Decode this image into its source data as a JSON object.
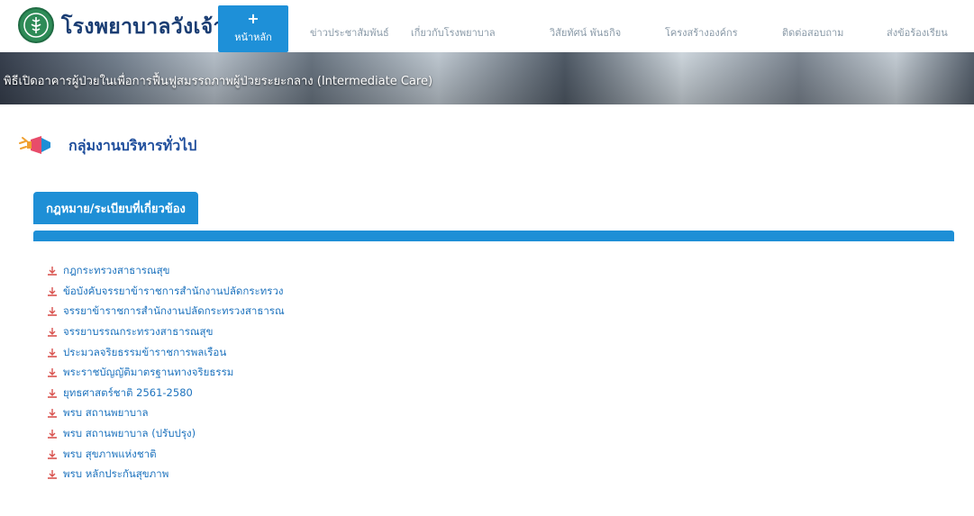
{
  "header": {
    "site_title": "โรงพยาบาลวังเจ้า",
    "logo_icon": "hospital-emblem-icon"
  },
  "nav": {
    "home": {
      "icon": "plus-icon",
      "label": "หน้าหลัก"
    },
    "items": [
      {
        "label": "ข่าวประชาสัมพันธ์"
      },
      {
        "label": "เกี่ยวกับโรงพยาบาล"
      },
      {
        "label": "วิสัยทัศน์ พันธกิจ"
      },
      {
        "label": "โครงสร้างองค์กร"
      },
      {
        "label": "ติดต่อสอบถาม"
      },
      {
        "label": "ส่งข้อร้องเรียน"
      }
    ]
  },
  "banner": {
    "caption": "พิธีเปิดอาคารผู้ป่วยในเพื่อการฟื้นฟูสมรรถภาพผู้ป่วยระยะกลาง (Intermediate Care)"
  },
  "section": {
    "icon": "megaphone-icon",
    "title": "กลุ่มงานบริหารทั่วไป"
  },
  "tab": {
    "label": "กฎหมาย/ระเบียบที่เกี่ยวข้อง"
  },
  "documents": [
    {
      "label": "กฎกระทรวงสาธารณสุข"
    },
    {
      "label": "ข้อบังคับจรรยาข้าราชการสำนักงานปลัดกระทรวง"
    },
    {
      "label": "จรรยาข้าราชการสำนักงานปลัดกระทรวงสาธารณ"
    },
    {
      "label": "จรรยาบรรณกระทรวงสาธารณสุข"
    },
    {
      "label": "ประมวลจริยธรรมข้าราชการพลเรือน"
    },
    {
      "label": "พระราชบัญญัติมาตรฐานทางจริยธรรม"
    },
    {
      "label": "ยุทธศาสตร์ชาติ 2561-2580"
    },
    {
      "label": "พรบ สถานพยาบาล"
    },
    {
      "label": "พรบ สถานพยาบาล (ปรับปรุง)"
    },
    {
      "label": "พรบ สุขภาพแห่งชาติ"
    },
    {
      "label": "พรบ หลักประกันสุขภาพ"
    }
  ],
  "colors": {
    "brand_blue": "#1e8fd6",
    "title_blue": "#1a3d73",
    "link_blue": "#1e73be",
    "pdf_red": "#d9534f"
  }
}
